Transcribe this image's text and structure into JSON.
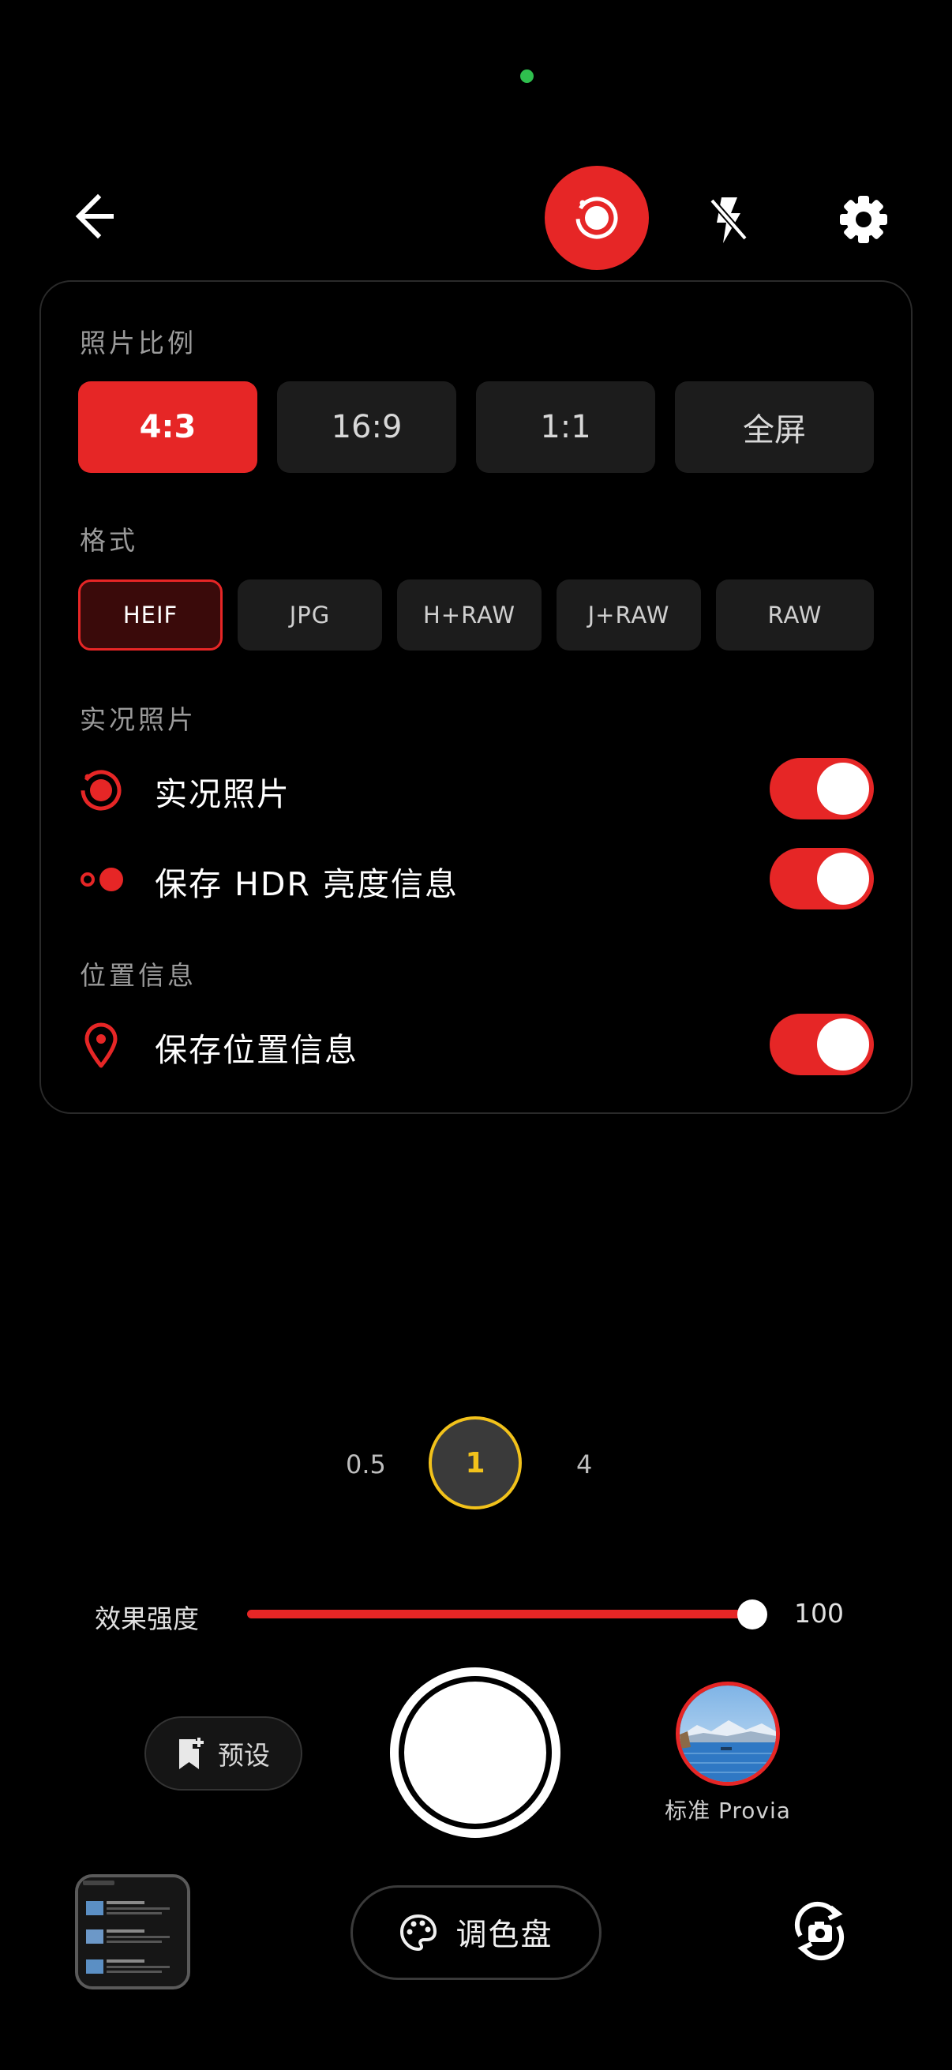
{
  "top_bar": {
    "back_icon": "arrow-left-icon",
    "live_icon": "live-photo-icon",
    "flash_icon": "flash-off-icon",
    "settings_icon": "gear-icon"
  },
  "panel": {
    "ratio_section": {
      "label": "照片比例",
      "options": [
        "4:3",
        "16:9",
        "1:1",
        "全屏"
      ],
      "selected": "4:3"
    },
    "format_section": {
      "label": "格式",
      "options": [
        "HEIF",
        "JPG",
        "H+RAW",
        "J+RAW",
        "RAW"
      ],
      "selected": "HEIF"
    },
    "live_section": {
      "label": "实况照片",
      "rows": [
        {
          "label": "实况照片",
          "icon": "live-photo-icon",
          "enabled": true
        },
        {
          "label": "保存 HDR 亮度信息",
          "icon": "hdr-dots-icon",
          "enabled": true
        }
      ]
    },
    "location_section": {
      "label": "位置信息",
      "rows": [
        {
          "label": "保存位置信息",
          "icon": "location-pin-icon",
          "enabled": true
        }
      ]
    }
  },
  "zoom": {
    "options": [
      "0.5",
      "1",
      "4"
    ],
    "selected": "1"
  },
  "strength": {
    "label": "效果强度",
    "value": "100",
    "fraction": 1.0
  },
  "preset": {
    "label": "预设",
    "icon": "bookmark-add-icon"
  },
  "film": {
    "label": "标准 Provia"
  },
  "palette": {
    "label": "调色盘",
    "icon": "palette-icon"
  },
  "switch_camera_icon": "camera-switch-icon",
  "colors": {
    "accent": "#e62626",
    "zoom_accent": "#f2c21b",
    "background": "#000000",
    "chip": "#1c1c1c"
  }
}
